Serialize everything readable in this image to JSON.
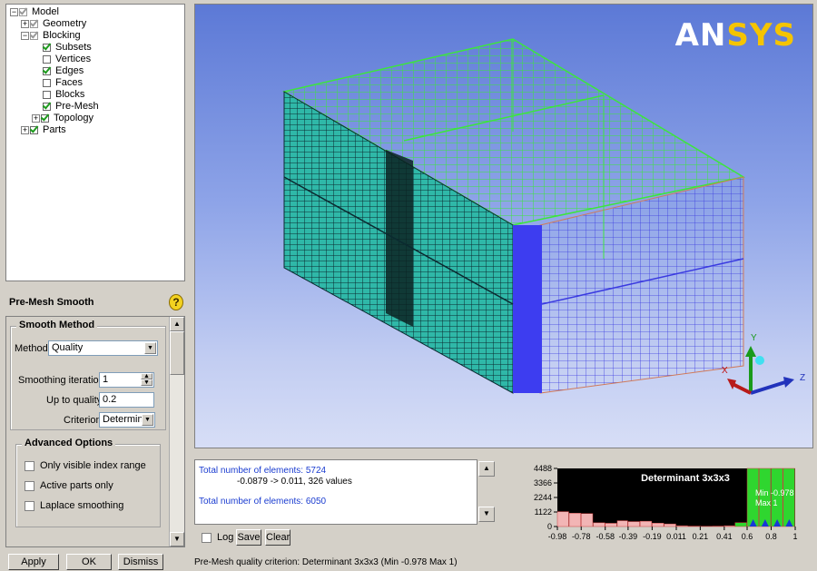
{
  "tree": {
    "model": "Model",
    "geometry": "Geometry",
    "blocking": "Blocking",
    "subsets": "Subsets",
    "vertices": "Vertices",
    "edges": "Edges",
    "faces": "Faces",
    "blocks": "Blocks",
    "premesh": "Pre-Mesh",
    "topology": "Topology",
    "parts": "Parts"
  },
  "panel": {
    "title": "Pre-Mesh Smooth",
    "help_icon": "?",
    "smooth_method_title": "Smooth Method",
    "method_label": "Method",
    "method_value": "Quality",
    "iterations_label": "Smoothing iterations",
    "iterations_value": "1",
    "quality_label": "Up to quality",
    "quality_value": "0.2",
    "criterion_label": "Criterion",
    "criterion_value": "Determinar",
    "advanced_title": "Advanced Options",
    "only_visible": "Only visible index range",
    "active_parts": "Active parts only",
    "laplace": "Laplace smoothing",
    "apply": "Apply",
    "ok": "OK",
    "dismiss": "Dismiss"
  },
  "viewport": {
    "logo": "ANSYS",
    "axis_x": "X",
    "axis_y": "Y",
    "axis_z": "Z"
  },
  "messages": {
    "line1": "Total number of elements: 5724",
    "line2": "-0.0879 -> 0.011, 326 values",
    "line3": "Total number of elements: 6050",
    "log_label": "Log",
    "save": "Save",
    "clear": "Clear"
  },
  "status": "Pre-Mesh quality criterion: Determinant 3x3x3 (Min -0.978 Max 1)",
  "chart_data": {
    "type": "bar",
    "title": "Determinant 3x3x3",
    "annotation_min": "Min -0.978",
    "annotation_max": "Max 1",
    "y_ticks": [
      "4488",
      "3366",
      "2244",
      "1122",
      "0"
    ],
    "x_ticks": [
      "-0.98",
      "-0.78",
      "-0.58",
      "-0.39",
      "-0.19",
      "0.011",
      "0.21",
      "0.41",
      "0.6",
      "0.8",
      "1"
    ],
    "ylim": [
      0,
      4488
    ],
    "xlim": [
      -0.978,
      1
    ],
    "bins": [
      {
        "x0": -0.978,
        "x1": -0.88,
        "value": 1150,
        "color": "#f2b5b5"
      },
      {
        "x0": -0.88,
        "x1": -0.78,
        "value": 1030,
        "color": "#f2b5b5"
      },
      {
        "x0": -0.78,
        "x1": -0.68,
        "value": 1000,
        "color": "#f2b5b5"
      },
      {
        "x0": -0.68,
        "x1": -0.58,
        "value": 290,
        "color": "#f2b5b5"
      },
      {
        "x0": -0.58,
        "x1": -0.48,
        "value": 250,
        "color": "#f2b5b5"
      },
      {
        "x0": -0.48,
        "x1": -0.39,
        "value": 450,
        "color": "#f2b5b5"
      },
      {
        "x0": -0.39,
        "x1": -0.29,
        "value": 380,
        "color": "#f2b5b5"
      },
      {
        "x0": -0.29,
        "x1": -0.19,
        "value": 410,
        "color": "#f2b5b5"
      },
      {
        "x0": -0.19,
        "x1": -0.09,
        "value": 260,
        "color": "#f2b5b5"
      },
      {
        "x0": -0.09,
        "x1": 0.011,
        "value": 200,
        "color": "#f2b5b5"
      },
      {
        "x0": 0.011,
        "x1": 0.11,
        "value": 60,
        "color": "#f2b5b5"
      },
      {
        "x0": 0.11,
        "x1": 0.21,
        "value": 30,
        "color": "#f2b5b5"
      },
      {
        "x0": 0.21,
        "x1": 0.31,
        "value": 20,
        "color": "#f2b5b5"
      },
      {
        "x0": 0.31,
        "x1": 0.41,
        "value": 30,
        "color": "#f2b5b5"
      },
      {
        "x0": 0.41,
        "x1": 0.5,
        "value": 60,
        "color": "#f2b5b5"
      },
      {
        "x0": 0.5,
        "x1": 0.6,
        "value": 300,
        "color": "#2fd62f"
      },
      {
        "x0": 0.6,
        "x1": 0.7,
        "value": 4488,
        "color": "#2fd62f"
      },
      {
        "x0": 0.7,
        "x1": 0.8,
        "value": 4488,
        "color": "#2fd62f"
      },
      {
        "x0": 0.8,
        "x1": 0.9,
        "value": 4488,
        "color": "#2fd62f"
      },
      {
        "x0": 0.9,
        "x1": 1.0,
        "value": 4488,
        "color": "#2fd62f"
      }
    ],
    "grid": false
  }
}
